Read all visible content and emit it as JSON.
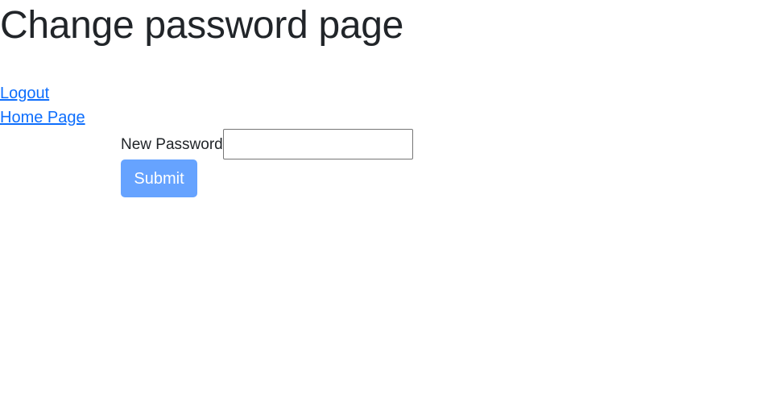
{
  "page": {
    "title": "Change password page"
  },
  "nav": {
    "logout_label": "Logout",
    "home_label": "Home Page"
  },
  "form": {
    "new_password_label": "New Password",
    "new_password_value": "",
    "submit_label": "Submit"
  },
  "colors": {
    "link": "#0d6efd",
    "button_bg": "#66a3ff",
    "button_text": "#ffffff",
    "heading": "#212529"
  }
}
